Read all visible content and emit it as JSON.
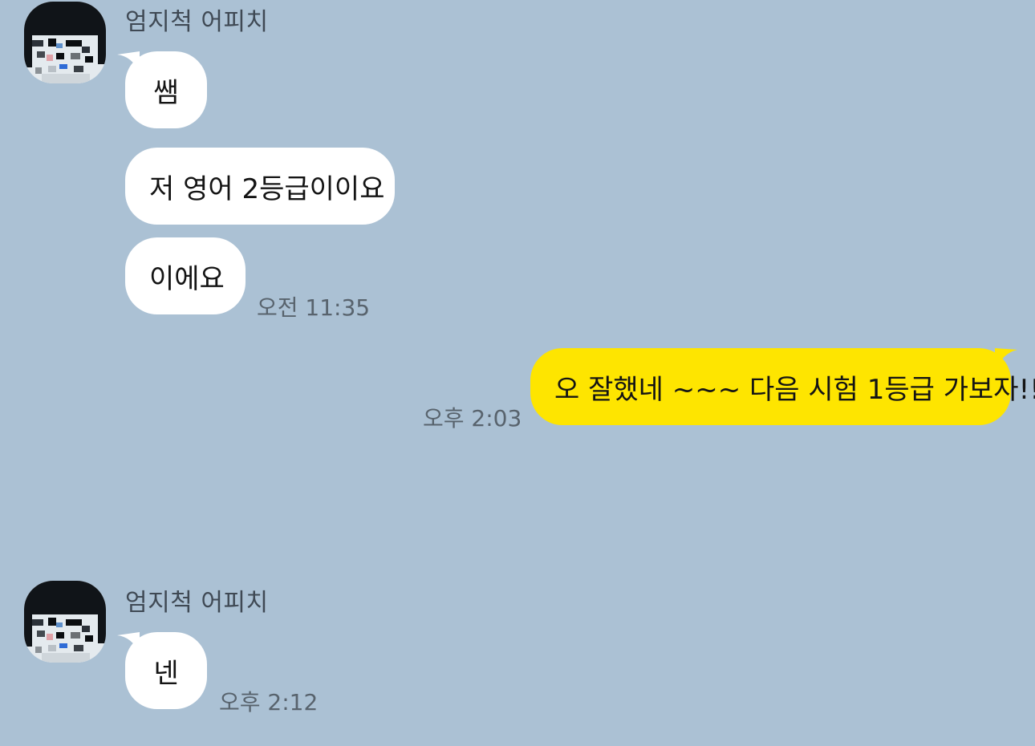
{
  "chat": {
    "groups": [
      {
        "sender": "엄지척 어피치",
        "messages": [
          "쌤",
          "저 영어 2등급이이요",
          "이에요"
        ],
        "time": "오전 11:35"
      },
      {
        "sender": "엄지척 어피치",
        "messages": [
          "넨"
        ],
        "time": "오후 2:12"
      }
    ],
    "outgoing": {
      "message": "오 잘했네 ~~~ 다음 시험 1등급 가보자!!",
      "time": "오후 2:03"
    }
  },
  "colors": {
    "background": "#abc1d4",
    "incoming_bubble": "#ffffff",
    "outgoing_bubble": "#fee500",
    "timestamp": "#58636d"
  },
  "icons": {
    "avatar": "profile-avatar-icon"
  }
}
